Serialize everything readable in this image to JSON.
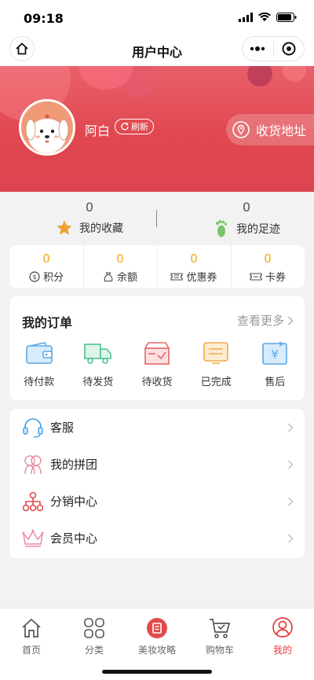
{
  "status_bar": {
    "time": "09:18"
  },
  "nav": {
    "title": "用户中心"
  },
  "profile": {
    "username": "阿白",
    "refresh_label": "刷新",
    "address_label": "收货地址"
  },
  "stats": [
    {
      "count": "0",
      "label": "我的收藏",
      "icon": "star-icon"
    },
    {
      "count": "0",
      "label": "我的足迹",
      "icon": "footprint-icon"
    }
  ],
  "assets": [
    {
      "value": "0",
      "label": "积分",
      "icon": "points-icon"
    },
    {
      "value": "0",
      "label": "余额",
      "icon": "wallet-bag-icon"
    },
    {
      "value": "0",
      "label": "优惠券",
      "icon": "coupon-icon"
    },
    {
      "value": "0",
      "label": "卡券",
      "icon": "card-ticket-icon"
    }
  ],
  "orders": {
    "title": "我的订单",
    "more": "查看更多",
    "items": [
      {
        "label": "待付款",
        "icon": "wallet-icon",
        "color": "#5aa9e6"
      },
      {
        "label": "待发货",
        "icon": "truck-icon",
        "color": "#4cc18c"
      },
      {
        "label": "待收货",
        "icon": "box-icon",
        "color": "#e8646a"
      },
      {
        "label": "已完成",
        "icon": "document-icon",
        "color": "#f2a94a"
      },
      {
        "label": "售后",
        "icon": "after-sale-icon",
        "color": "#5aa9e6"
      }
    ]
  },
  "menu": [
    {
      "label": "客服",
      "icon": "headset-icon",
      "color": "#3aa0e0"
    },
    {
      "label": "我的拼团",
      "icon": "group-icon",
      "color": "#e88ca0"
    },
    {
      "label": "分销中心",
      "icon": "hierarchy-icon",
      "color": "#e34b4b"
    },
    {
      "label": "会员中心",
      "icon": "crown-icon",
      "color": "#e88ca0"
    }
  ],
  "tabbar": [
    {
      "label": "首页",
      "icon": "home-icon"
    },
    {
      "label": "分类",
      "icon": "category-icon"
    },
    {
      "label": "美妆攻略",
      "icon": "book-icon"
    },
    {
      "label": "购物车",
      "icon": "cart-icon"
    },
    {
      "label": "我的",
      "icon": "user-icon",
      "active": true
    }
  ],
  "colors": {
    "accent": "#e53b3b",
    "header_red": "#e0474f",
    "asset_value": "#f0a817"
  }
}
